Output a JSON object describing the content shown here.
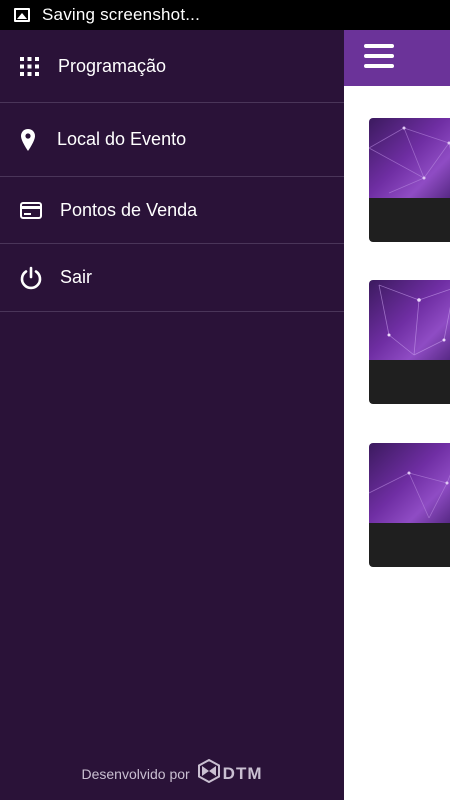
{
  "status_bar": {
    "notification_icon": "image-icon",
    "text": "Saving screenshot..."
  },
  "drawer": {
    "items": [
      {
        "label": "Programação",
        "icon": "grid-dots-icon"
      },
      {
        "label": "Local do Evento",
        "icon": "location-pin-icon"
      },
      {
        "label": "Pontos de Venda",
        "icon": "credit-card-icon"
      },
      {
        "label": "Sair",
        "icon": "power-icon"
      }
    ],
    "footer": {
      "developed_by": "Desenvolvido por",
      "brand": "DTM"
    }
  },
  "app_bar": {
    "menu_icon": "hamburger-menu-icon",
    "color": "#6b3399"
  },
  "colors": {
    "drawer_bg": "#2a1238",
    "divider": "#4a3559",
    "accent": "#6b3399"
  }
}
